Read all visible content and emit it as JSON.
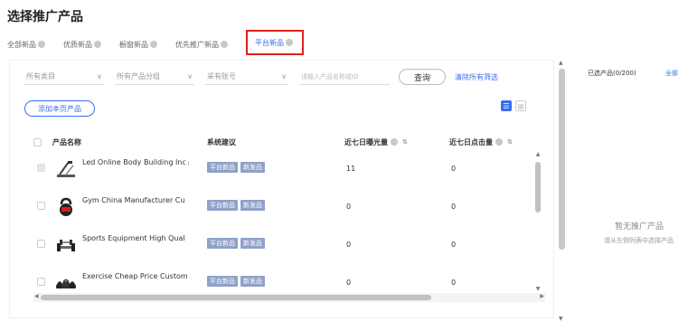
{
  "page": {
    "title": "选择推广产品"
  },
  "tabs": [
    {
      "label": "全部新品",
      "active": false
    },
    {
      "label": "优质新品",
      "active": false
    },
    {
      "label": "橱窗新品",
      "active": false
    },
    {
      "label": "优先推广新品",
      "active": false
    },
    {
      "label": "平台新品",
      "active": true
    }
  ],
  "filters": {
    "category": "所有类目",
    "group": "所有产品分组",
    "account": "采有账号",
    "search_placeholder": "请输入产品名称或ID",
    "query_button": "查询",
    "clear_link": "清除所有筛选"
  },
  "add_button": "添加本页产品",
  "table": {
    "headers": {
      "name": "产品名称",
      "suggestion": "系统建议",
      "exposure": "近七日曝光量",
      "clicks": "近七日点击量"
    },
    "rows": [
      {
        "name": "Led Online Body Building Inc",
        "tags": [
          "平台新品",
          "新发品"
        ],
        "exposure": "11",
        "clicks": "0",
        "thumb": "gym-machine-icon",
        "has_info": true
      },
      {
        "name": "Gym China Manufacturer Cu",
        "tags": [
          "平台新品",
          "新发品"
        ],
        "exposure": "0",
        "clicks": "0",
        "thumb": "kettlebell-icon",
        "has_info": false
      },
      {
        "name": "Sports Equipment High Qual",
        "tags": [
          "平台新品",
          "新发品"
        ],
        "exposure": "0",
        "clicks": "0",
        "thumb": "dumbbells-icon",
        "has_info": false
      },
      {
        "name": "Exercise Cheap Price Custom",
        "tags": [
          "平台新品",
          "新发品"
        ],
        "exposure": "0",
        "clicks": "0",
        "thumb": "kettlebell-set-icon",
        "has_info": false
      }
    ]
  },
  "right_panel": {
    "selected": "已选产品(0/200)",
    "select_all": "全部",
    "empty_title": "暂无推广产品",
    "empty_sub": "请从左侧列表中选择产品"
  },
  "colors": {
    "accent": "#3a6df0",
    "tag": "#8fa1c8",
    "highlight": "#e02020"
  }
}
